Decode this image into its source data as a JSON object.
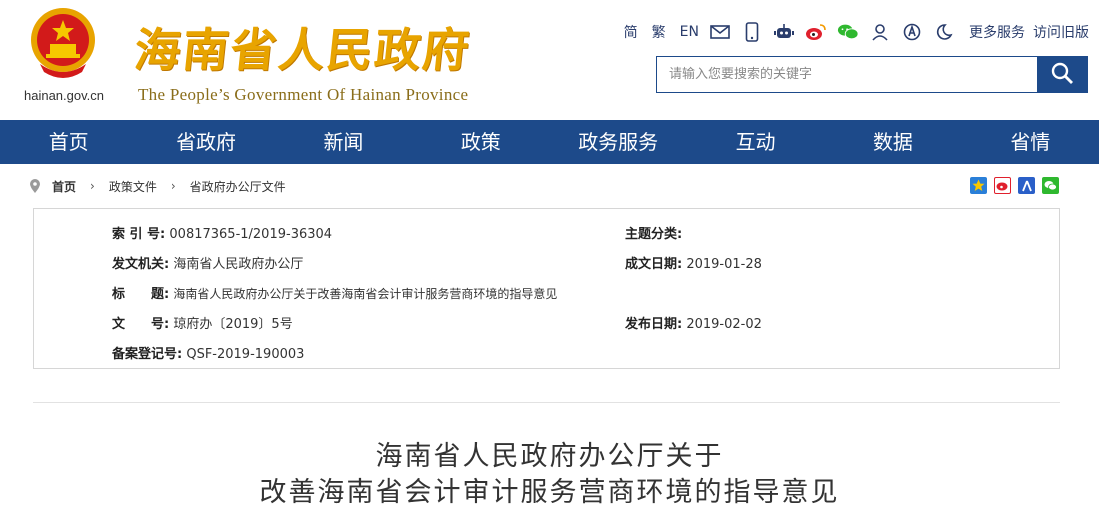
{
  "header": {
    "domain": "hainan.gov.cn",
    "site_title": "海南省人民政府",
    "site_subtitle": "The People’s Government Of Hainan Province",
    "links": {
      "simplified": "简",
      "traditional": "繁",
      "english": "EN",
      "more_services": "更多服务",
      "old_version": "访问旧版"
    },
    "search_placeholder": "请输入您要搜索的关键字",
    "colors": {
      "brand_blue": "#1d4a8a",
      "title_gold": "#e8a400"
    }
  },
  "nav": {
    "items": [
      "首页",
      "省政府",
      "新闻",
      "政策",
      "政务服务",
      "互动",
      "数据",
      "省情"
    ]
  },
  "breadcrumb": {
    "home": "首页",
    "level1": "政策文件",
    "level2": "省政府办公厅文件"
  },
  "meta": {
    "index_label": "索 引 号:",
    "index_value": "00817365-1/2019-36304",
    "topic_label": "主题分类:",
    "topic_value": "",
    "issuer_label": "发文机关:",
    "issuer_value": "海南省人民政府办公厅",
    "date_made_label": "成文日期:",
    "date_made_value": "2019-01-28",
    "title_label": "标　　题:",
    "title_value": "海南省人民政府办公厅关于改善海南省会计审计服务营商环境的指导意见",
    "docno_label": "文　　号:",
    "docno_value": "琼府办〔2019〕5号",
    "pub_label": "发布日期:",
    "pub_value": "2019-02-02",
    "record_label": "备案登记号:",
    "record_value": "QSF-2019-190003"
  },
  "document": {
    "title_line1": "海南省人民政府办公厅关于",
    "title_line2": "改善海南省会计审计服务营商环境的指导意见"
  }
}
